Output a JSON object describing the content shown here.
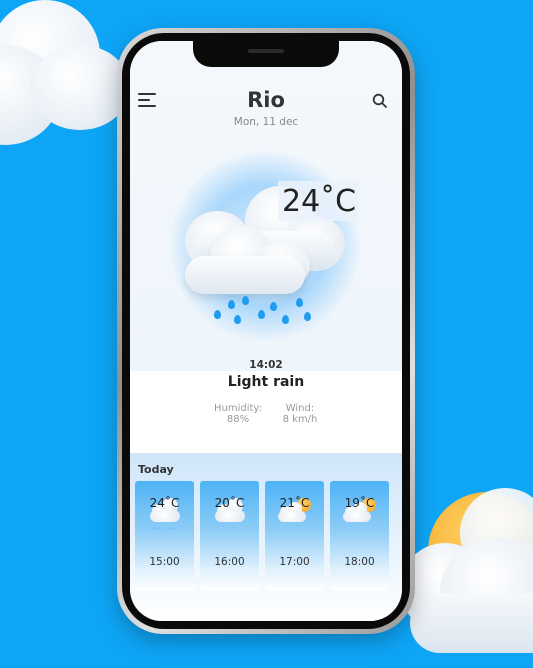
{
  "colors": {
    "background": "#0ea5f6",
    "accent_blue": "#1f9cf0",
    "sun": "#f6ad2b"
  },
  "header": {
    "menu_icon": "hamburger-menu-icon",
    "city": "Rio",
    "date": "Mon, 11 dec",
    "search_icon": "search-icon"
  },
  "current": {
    "temperature": "24˚C",
    "icon": "cloud-rain-icon",
    "time": "14:02",
    "condition": "Light rain",
    "humidity_label": "Humidity:",
    "humidity_value": "88%",
    "wind_label": "Wind:",
    "wind_value": "8 km/h"
  },
  "today": {
    "label": "Today",
    "hours": [
      {
        "temp": "24˚C",
        "time": "15:00",
        "icon": "cloud-rain-icon"
      },
      {
        "temp": "20˚C",
        "time": "16:00",
        "icon": "cloud-icon"
      },
      {
        "temp": "21˚C",
        "time": "17:00",
        "icon": "partly-cloudy-icon"
      },
      {
        "temp": "19˚C",
        "time": "18:00",
        "icon": "partly-cloudy-icon"
      }
    ]
  }
}
